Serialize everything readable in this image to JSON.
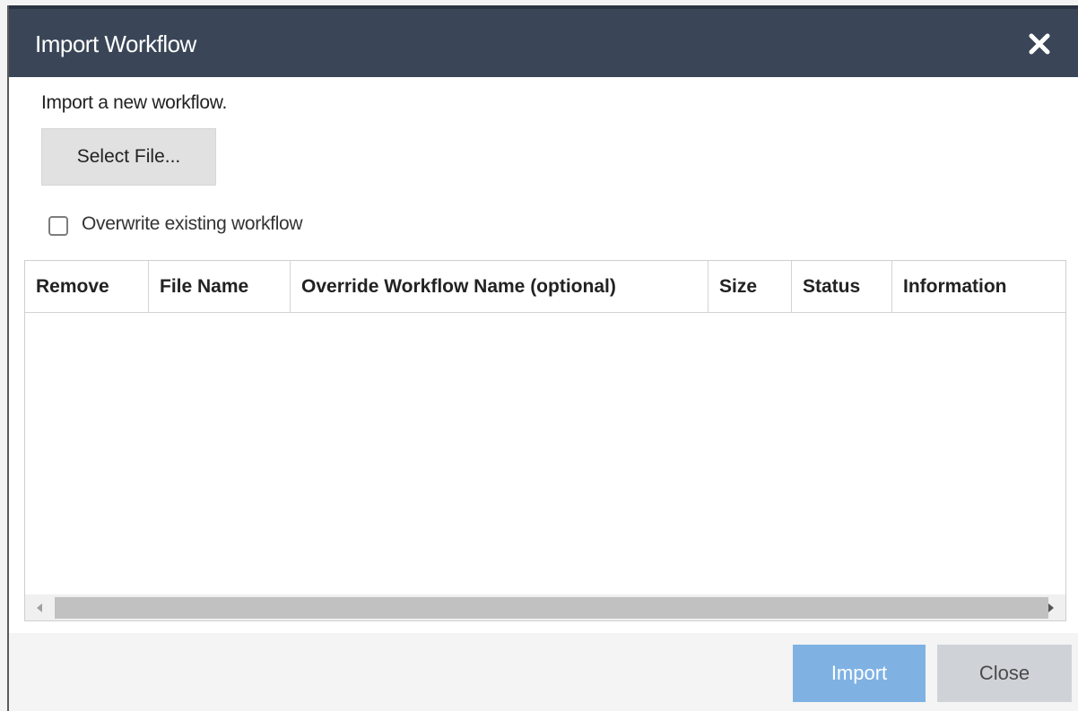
{
  "dialog": {
    "title": "Import Workflow",
    "close_icon": "close-x-icon"
  },
  "body": {
    "description": "Import a new workflow.",
    "select_file_label": "Select File...",
    "overwrite_label": "Overwrite existing workflow",
    "overwrite_checked": false
  },
  "table": {
    "columns": [
      "Remove",
      "File Name",
      "Override Workflow Name (optional)",
      "Size",
      "Status",
      "Information"
    ],
    "rows": []
  },
  "footer": {
    "import_label": "Import",
    "close_label": "Close"
  },
  "colors": {
    "titlebar": "#3a4657",
    "import_button_disabled": "#7fb2e3",
    "close_button": "#cfd3d8"
  }
}
